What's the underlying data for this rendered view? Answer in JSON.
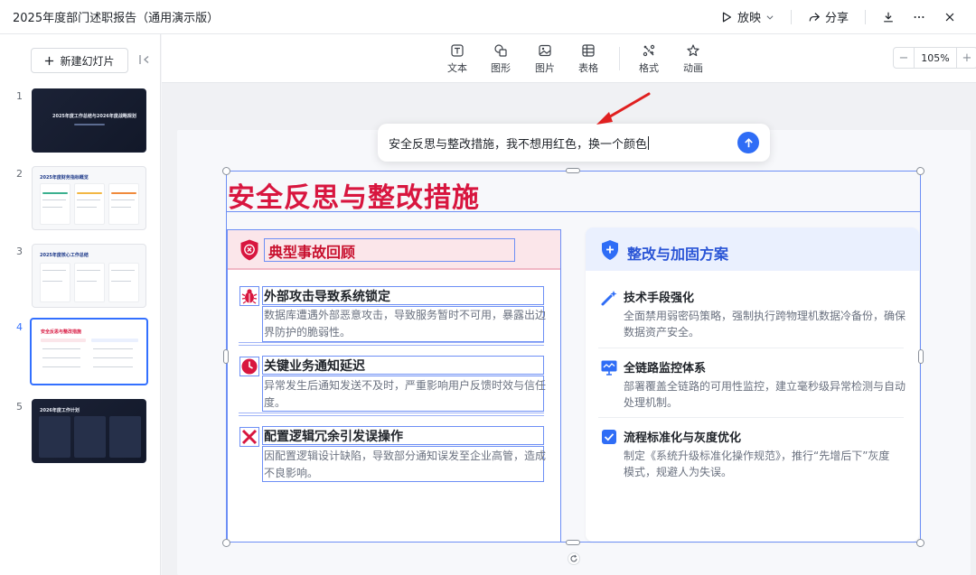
{
  "titlebar": {
    "doc_title": "2025年度部门述职报告（通用演示版）",
    "present_label": "放映",
    "share_label": "分享"
  },
  "left_panel": {
    "new_slide_label": "新建幻灯片",
    "thumbnails": [
      {
        "num": "1",
        "title": "2025年度工作总结与2026年度战略规划"
      },
      {
        "num": "2",
        "title": "2025年度财务指标概览"
      },
      {
        "num": "3",
        "title": "2025年度核心工作总结"
      },
      {
        "num": "4",
        "title": "安全反思与整改措施"
      },
      {
        "num": "5",
        "title": "2026年度工作计划"
      }
    ]
  },
  "toolbar": {
    "text": "文本",
    "shape": "图形",
    "image": "图片",
    "table": "表格",
    "format": "格式",
    "animation": "动画",
    "zoom_value": "105%",
    "zoom_minus": "−",
    "zoom_plus": "+"
  },
  "prompt": {
    "text": "安全反思与整改措施，我不想用红色，换一个颜色"
  },
  "slide": {
    "title": "安全反思与整改措施",
    "left": {
      "heading": "典型事故回顾",
      "items": [
        {
          "title": "外部攻击导致系统锁定",
          "desc_line1": "数据库遭遇外部恶意攻击，导致服务暂时不可用，暴露出边",
          "desc_line2": "界防护的脆弱性。"
        },
        {
          "title": "关键业务通知延迟",
          "desc_line1": "异常发生后通知发送不及时，严重影响用户反馈时效与信任",
          "desc_line2": "度。"
        },
        {
          "title": "配置逻辑冗余引发误操作",
          "desc_line1": "因配置逻辑设计缺陷，导致部分通知误发至企业高管，造成",
          "desc_line2": "不良影响。"
        }
      ]
    },
    "right": {
      "heading": "整改与加固方案",
      "items": [
        {
          "title": "技术手段强化",
          "desc_line1": "全面禁用弱密码策略，强制执行跨物理机数据冷备份，确保",
          "desc_line2": "数据资产安全。"
        },
        {
          "title": "全链路监控体系",
          "desc_line1": "部署覆盖全链路的可用性监控，建立毫秒级异常检测与自动",
          "desc_line2": "处理机制。"
        },
        {
          "title": "流程标准化与灰度优化",
          "desc_line1": "制定《系统升级标准化操作规范》，推行“先增后下”灰度",
          "desc_line2": "模式，规避人为失误。"
        }
      ]
    }
  },
  "colors": {
    "accent_red": "#d8163f",
    "accent_blue": "#2f6df6",
    "selection_blue": "#6d8ff5"
  }
}
